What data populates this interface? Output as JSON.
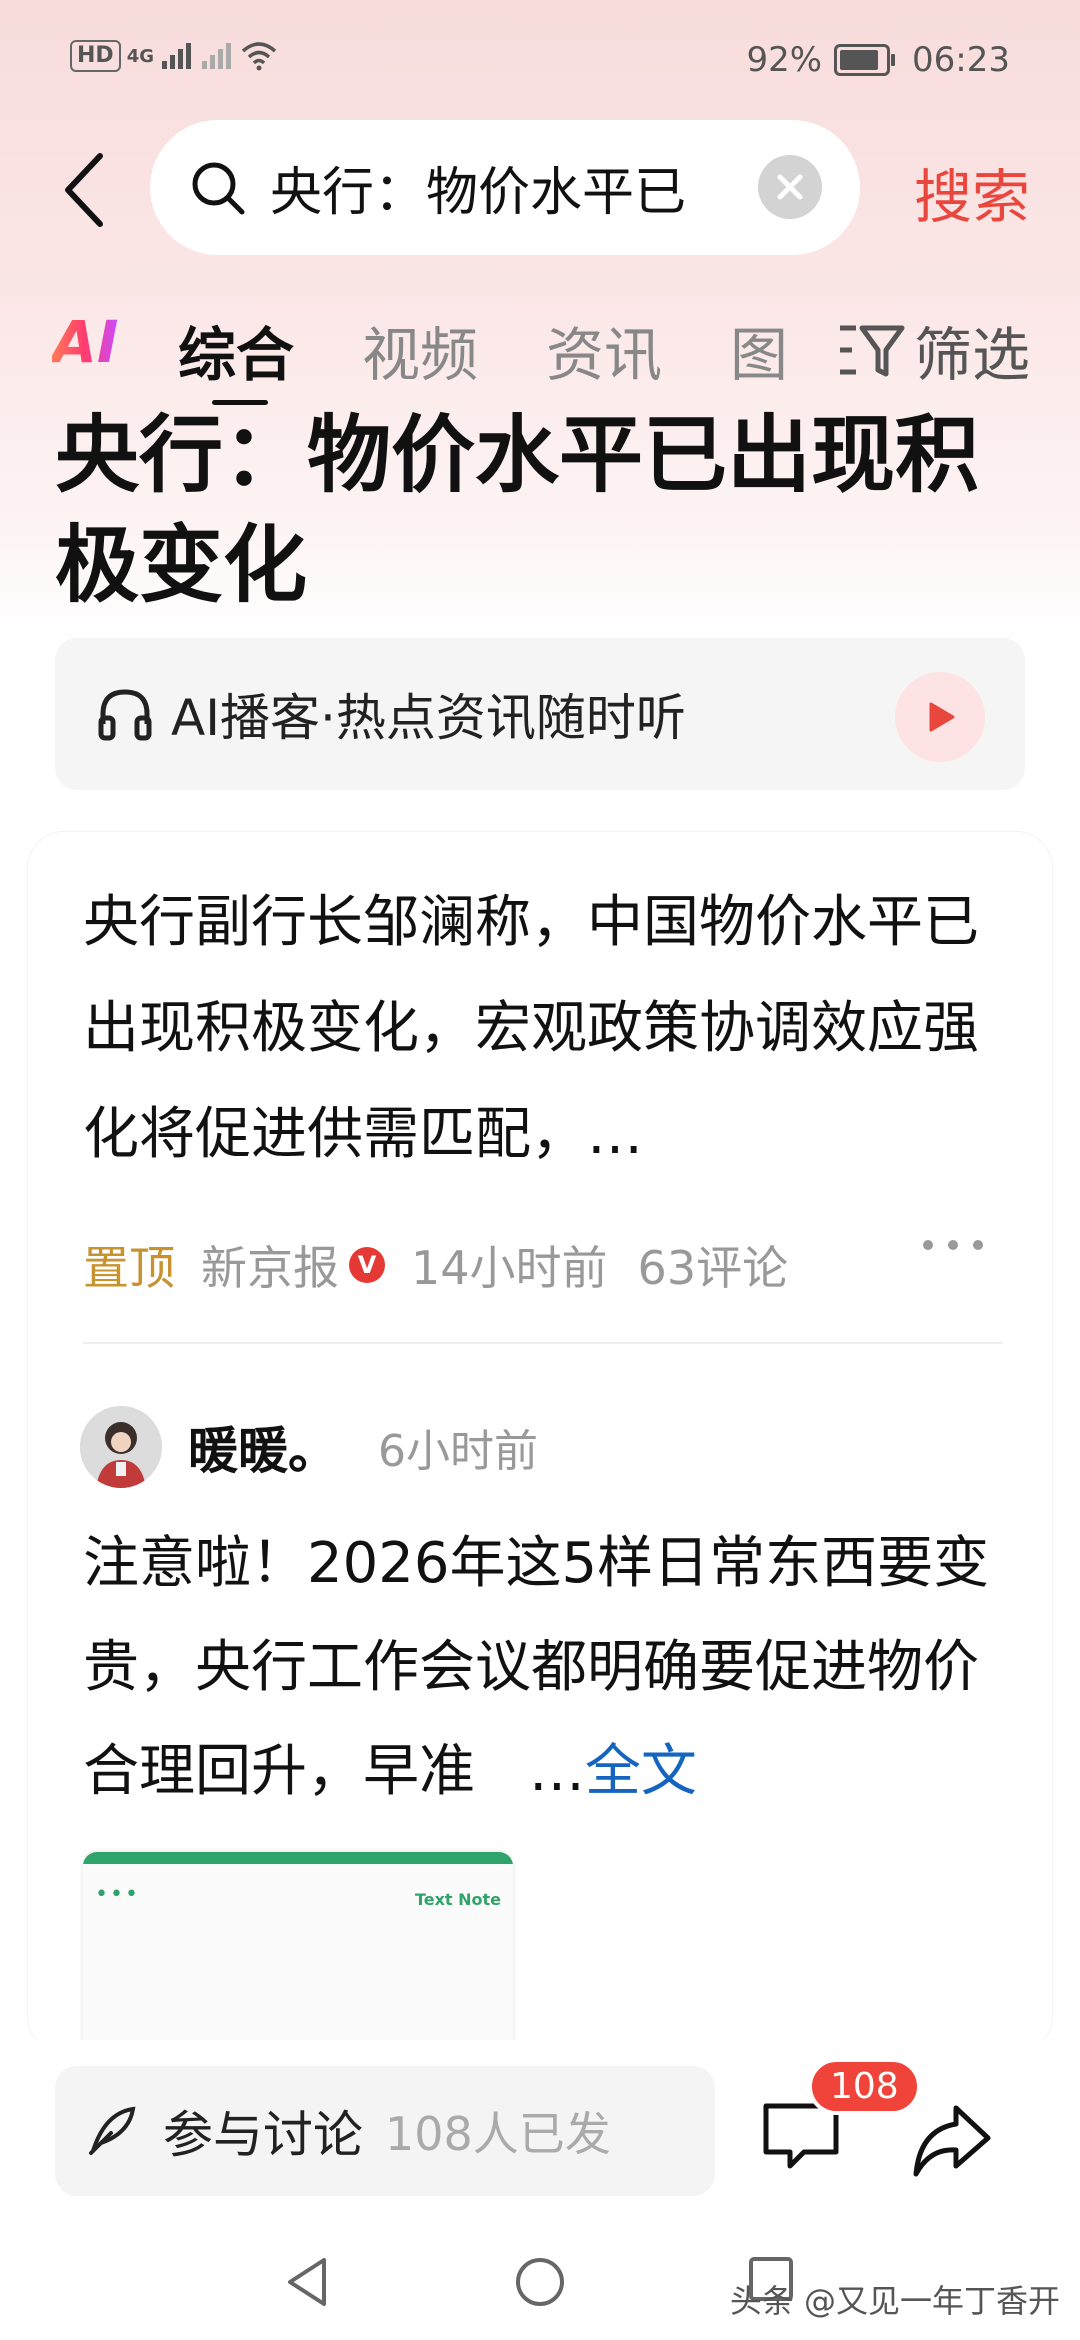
{
  "status_bar": {
    "left_badges": [
      "HD",
      "4G"
    ],
    "battery": "92%",
    "time": "06:23"
  },
  "search": {
    "query": "央行：物价水平已",
    "button": "搜索"
  },
  "tabs": {
    "ai_label": "AI",
    "items": [
      "综合",
      "视频",
      "资讯",
      "图"
    ],
    "active": "综合",
    "filter_label": "筛选"
  },
  "headline": "央行：物价水平已出现积极变化",
  "podcast": {
    "label": "AI播客·热点资讯随时听"
  },
  "article": {
    "snippet": "央行副行长邹澜称，中国物价水平已出现积极变化，宏观政策协调效应强化将促进供需匹配，…",
    "pin": "置顶",
    "source": "新京报",
    "verified_mark": "V",
    "time": "14小时前",
    "comments": "63评论"
  },
  "post": {
    "username": "暖暖。",
    "time": "6小时前",
    "text": "注意啦！2026年这5样日常东西要变贵，央行工作会议都明确要促进物价合理回升，早准",
    "ellipsis": "…",
    "full_text_link": "全文",
    "thumbnail_dots": "•••",
    "thumbnail_label": "Text Note"
  },
  "bottom_bar": {
    "discuss_label": "参与讨论",
    "discuss_count": "108人已发",
    "comment_badge": "108"
  },
  "watermark": "头条 @又见一年丁香开",
  "colors": {
    "accent_red": "#e9463e",
    "link_blue": "#1565c0",
    "pin_gold": "#c8922e"
  }
}
